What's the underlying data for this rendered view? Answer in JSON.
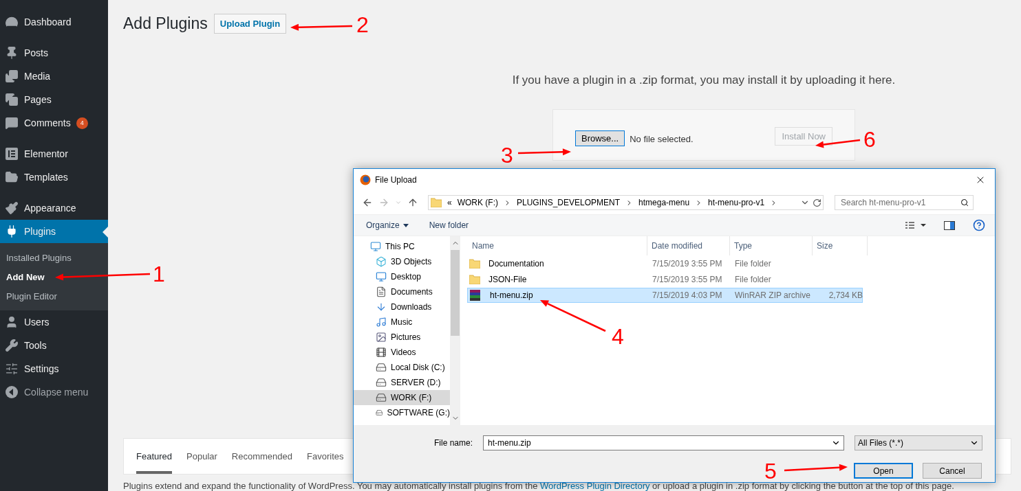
{
  "sidebar": {
    "groups": [
      [
        {
          "label": "Dashboard",
          "selected": false
        }
      ],
      [
        {
          "label": "Posts",
          "selected": false
        },
        {
          "label": "Media",
          "selected": false
        },
        {
          "label": "Pages",
          "selected": false
        },
        {
          "label": "Comments",
          "selected": false,
          "badge": "4"
        }
      ],
      [
        {
          "label": "Elementor",
          "selected": false
        },
        {
          "label": "Templates",
          "selected": false
        }
      ],
      [
        {
          "label": "Appearance",
          "selected": false
        },
        {
          "label": "Plugins",
          "selected": true,
          "children": [
            {
              "label": "Installed Plugins",
              "selected": false
            },
            {
              "label": "Add New",
              "selected": true
            },
            {
              "label": "Plugin Editor",
              "selected": false
            }
          ]
        },
        {
          "label": "Users",
          "selected": false
        },
        {
          "label": "Tools",
          "selected": false
        },
        {
          "label": "Settings",
          "selected": false
        },
        {
          "label": "Collapse menu",
          "selected": false,
          "kind": "collapse"
        }
      ]
    ]
  },
  "page": {
    "title": "Add Plugins",
    "upload_button": "Upload Plugin"
  },
  "upload": {
    "intro": "If you have a plugin in a .zip format, you may install it by uploading it here.",
    "browse_button": "Browse...",
    "file_status": "No file selected.",
    "install_button": {
      "label": "Install Now",
      "disabled": true
    }
  },
  "tabs": [
    {
      "label": "Featured",
      "selected": true
    },
    {
      "label": "Popular",
      "selected": false
    },
    {
      "label": "Recommended",
      "selected": false
    },
    {
      "label": "Favorites",
      "selected": false
    }
  ],
  "description": {
    "before": "Plugins extend and expand the functionality of WordPress. You may automatically install plugins from the ",
    "link": "WordPress Plugin Directory",
    "after": " or upload a plugin in .zip format by clicking the button at the top of this page."
  },
  "dialog": {
    "title": "File Upload",
    "overflow_mark": "«",
    "path": [
      "WORK (F:)",
      "PLUGINS_DEVELOPMENT",
      "htmega-menu",
      "ht-menu-pro-v1"
    ],
    "search": {
      "placeholder": "Search ht-menu-pro-v1"
    },
    "toolbar": {
      "organize": "Organize",
      "new_folder": "New folder"
    },
    "nav_pane": [
      {
        "label": "This PC",
        "selected": false
      },
      {
        "label": "3D Objects",
        "selected": false
      },
      {
        "label": "Desktop",
        "selected": false
      },
      {
        "label": "Documents",
        "selected": false
      },
      {
        "label": "Downloads",
        "selected": false
      },
      {
        "label": "Music",
        "selected": false
      },
      {
        "label": "Pictures",
        "selected": false
      },
      {
        "label": "Videos",
        "selected": false
      },
      {
        "label": "Local Disk (C:)",
        "selected": false
      },
      {
        "label": "SERVER (D:)",
        "selected": false
      },
      {
        "label": "WORK (F:)",
        "selected": true
      },
      {
        "label": "SOFTWARE (G:)",
        "selected": false
      }
    ],
    "columns": [
      "Name",
      "Date modified",
      "Type",
      "Size"
    ],
    "files": [
      {
        "name": "Documentation",
        "date": "7/15/2019 3:55 PM",
        "type": "File folder",
        "kind": "folder",
        "selected": false
      },
      {
        "name": "JSON-File",
        "date": "7/15/2019 3:55 PM",
        "type": "File folder",
        "kind": "folder",
        "selected": false
      },
      {
        "name": "ht-menu.zip",
        "date": "7/15/2019 4:03 PM",
        "type": "WinRAR ZIP archive",
        "size": "2,734 KB",
        "kind": "archive",
        "selected": true
      }
    ],
    "file_name": {
      "label": "File name:",
      "value": "ht-menu.zip"
    },
    "filter": "All Files (*.*)",
    "buttons": [
      {
        "label": "Open",
        "default": true
      },
      {
        "label": "Cancel",
        "default": false
      }
    ]
  },
  "annotations": [
    "1",
    "2",
    "3",
    "4",
    "5",
    "6"
  ]
}
